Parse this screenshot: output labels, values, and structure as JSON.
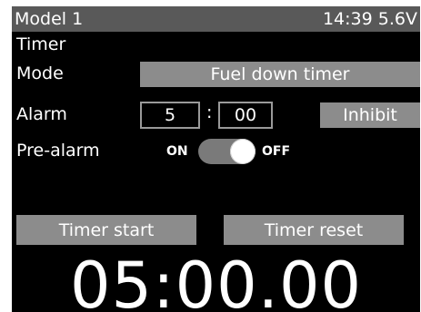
{
  "status_bar": {
    "model": "Model 1",
    "time": "14:39",
    "voltage": "5.6V"
  },
  "screen_title": "Timer",
  "mode": {
    "label": "Mode",
    "value": "Fuel down timer"
  },
  "alarm": {
    "label": "Alarm",
    "minutes": "5",
    "separator": ":",
    "seconds": "00",
    "inhibit_label": "Inhibit"
  },
  "pre_alarm": {
    "label": "Pre-alarm",
    "on_label": "ON",
    "off_label": "OFF",
    "state": "OFF"
  },
  "buttons": {
    "start_label": "Timer start",
    "reset_label": "Timer reset"
  },
  "timer": {
    "value": "05:00.00"
  },
  "colors": {
    "status_bar_bg": "#595959",
    "button_bg": "#8c8c8c",
    "screen_bg": "#000000",
    "text": "#ffffff"
  }
}
